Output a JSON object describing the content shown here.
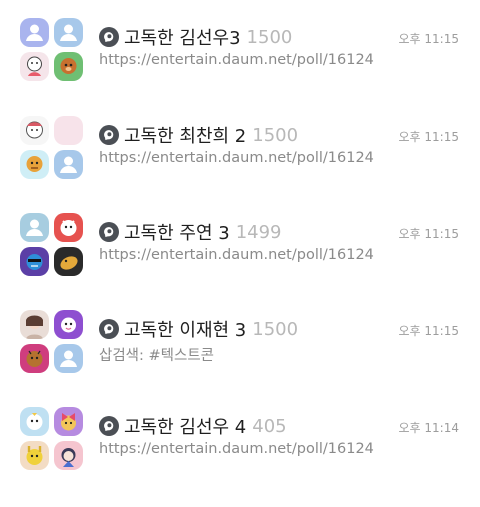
{
  "chats": [
    {
      "name": "고독한 김선우3",
      "count": "1500",
      "time": "오후 11:15",
      "preview": "https://entertain.daum.net/poll/16124",
      "avatars": [
        {
          "icon": "default-profile-icon",
          "bg": "#a9b4ee"
        },
        {
          "icon": "default-profile-icon",
          "bg": "#a7c8ea"
        },
        {
          "icon": "sticker-character-icon",
          "bg": "#f5e5ea"
        },
        {
          "icon": "sticker-character-icon",
          "bg": "#6fbf73"
        }
      ]
    },
    {
      "name": "고독한 최찬희 2",
      "count": "1500",
      "time": "오후 11:15",
      "preview": "https://entertain.daum.net/poll/16124",
      "avatars": [
        {
          "icon": "sticker-character-icon",
          "bg": "#f6f6f6"
        },
        {
          "icon": "blank-profile-icon",
          "bg": "#f7e3ea"
        },
        {
          "icon": "sticker-character-icon",
          "bg": "#cfeef6"
        },
        {
          "icon": "default-profile-icon",
          "bg": "#a7c8ea"
        }
      ]
    },
    {
      "name": "고독한 주연 3",
      "count": "1499",
      "time": "오후 11:15",
      "preview": "https://entertain.daum.net/poll/16124",
      "avatars": [
        {
          "icon": "default-profile-icon",
          "bg": "#a7cde0"
        },
        {
          "icon": "sticker-character-icon",
          "bg": "#e6524f"
        },
        {
          "icon": "sticker-character-icon",
          "bg": "#5b3fa6"
        },
        {
          "icon": "sticker-character-icon",
          "bg": "#2a2a2a"
        }
      ]
    },
    {
      "name": "고독한 이재현 3",
      "count": "1500",
      "time": "오후 11:15",
      "preview": "삽검색: #텍스트콘",
      "avatars": [
        {
          "icon": "photo-profile-icon",
          "bg": "#e9ddd7"
        },
        {
          "icon": "sticker-character-icon",
          "bg": "#8e4fd0"
        },
        {
          "icon": "sticker-character-icon",
          "bg": "#cf3d7e"
        },
        {
          "icon": "default-profile-icon",
          "bg": "#a7c8ea"
        }
      ]
    },
    {
      "name": "고독한 김선우 4",
      "count": "405",
      "time": "오후 11:14",
      "preview": "https://entertain.daum.net/poll/16124",
      "avatars": [
        {
          "icon": "sticker-character-icon",
          "bg": "#bfe0f2"
        },
        {
          "icon": "sticker-character-icon",
          "bg": "#b68be0"
        },
        {
          "icon": "sticker-character-icon",
          "bg": "#f3dcc4"
        },
        {
          "icon": "sticker-character-icon",
          "bg": "#f5c5cf"
        }
      ]
    }
  ]
}
